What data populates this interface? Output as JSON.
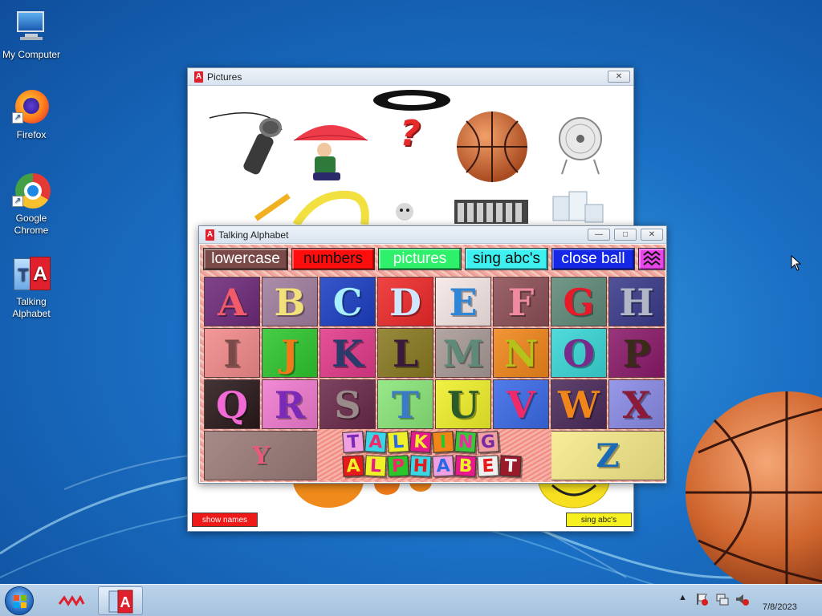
{
  "desktop": {
    "icons": [
      {
        "label": "My Computer"
      },
      {
        "label": "Firefox"
      },
      {
        "label": "Google Chrome"
      },
      {
        "label": "Talking Alphabet"
      }
    ]
  },
  "pictures_window": {
    "title": "Pictures",
    "icon_letter": "A",
    "close_label": "✕",
    "question_mark": "?",
    "show_names_label": "show names",
    "sing_abcs_label": "sing abc's"
  },
  "alphabet_window": {
    "title": "Talking Alphabet",
    "icon_letter": "A",
    "minimize_label": "—",
    "maximize_label": "□",
    "close_label": "✕",
    "menu": [
      {
        "label": "lowercase",
        "bg": "#7a4a48",
        "color": "#ffffff"
      },
      {
        "label": "numbers",
        "bg": "#ff0d0d",
        "color": "#111111"
      },
      {
        "label": "pictures",
        "bg": "#2ef06a",
        "color": "#ffffff"
      },
      {
        "label": "sing abc's",
        "bg": "#3ef0f0",
        "color": "#111111"
      },
      {
        "label": "close ball",
        "bg": "#1428e6",
        "color": "#ffffff"
      },
      {
        "label": "",
        "bg": "#e646e6",
        "color": "#111111"
      }
    ],
    "letters": [
      {
        "ch": "A",
        "bg": "#6e2a7a",
        "fg": "#f05a6a"
      },
      {
        "ch": "B",
        "bg": "#a07e9e",
        "fg": "#f2e07a"
      },
      {
        "ch": "C",
        "bg": "#1c3fc2",
        "fg": "#a8f0ff"
      },
      {
        "ch": "D",
        "bg": "#ee2a2a",
        "fg": "#cfe6ff"
      },
      {
        "ch": "E",
        "bg": "#f6e8e6",
        "fg": "#2f86d6"
      },
      {
        "ch": "F",
        "bg": "#8c4f56",
        "fg": "#f08aa0"
      },
      {
        "ch": "G",
        "bg": "#5f8a7a",
        "fg": "#e81a2a"
      },
      {
        "ch": "H",
        "bg": "#3a3a8a",
        "fg": "#b0b6c6"
      },
      {
        "ch": "I",
        "bg": "#f28a8a",
        "fg": "#7a4a48"
      },
      {
        "ch": "J",
        "bg": "#2ec62e",
        "fg": "#f07a1a"
      },
      {
        "ch": "K",
        "bg": "#e23a8a",
        "fg": "#2a3a6a"
      },
      {
        "ch": "L",
        "bg": "#8a7a22",
        "fg": "#3a1a3a"
      },
      {
        "ch": "M",
        "bg": "#a89a96",
        "fg": "#5f8a7a"
      },
      {
        "ch": "N",
        "bg": "#f0861a",
        "fg": "#b6c21a"
      },
      {
        "ch": "O",
        "bg": "#3ad6d6",
        "fg": "#7a2a8a"
      },
      {
        "ch": "P",
        "bg": "#8a1a6a",
        "fg": "#3a2a1a"
      },
      {
        "ch": "Q",
        "bg": "#2a1a1a",
        "fg": "#f26ad6"
      },
      {
        "ch": "R",
        "bg": "#f07ad0",
        "fg": "#7a2ab6"
      },
      {
        "ch": "S",
        "bg": "#6a2a4a",
        "fg": "#9a8a8a"
      },
      {
        "ch": "T",
        "bg": "#8ae67a",
        "fg": "#3a7ac6"
      },
      {
        "ch": "U",
        "bg": "#f0f02a",
        "fg": "#2a5a2a"
      },
      {
        "ch": "V",
        "bg": "#3a6ae6",
        "fg": "#f02a6a"
      },
      {
        "ch": "W",
        "bg": "#4a2a5a",
        "fg": "#f0861a"
      },
      {
        "ch": "X",
        "bg": "#8a8ae6",
        "fg": "#8a1a3a"
      },
      {
        "ch": "Y",
        "bg": "#9a7a78",
        "fg": "#e65a7a"
      },
      {
        "ch": "Z",
        "bg": "#f6ea8a",
        "fg": "#1a6ab6"
      }
    ],
    "logo_top": [
      {
        "ch": "T",
        "bg": "#f0a0e0",
        "fg": "#7a2ab6"
      },
      {
        "ch": "A",
        "bg": "#3ad6e6",
        "fg": "#f02a6a"
      },
      {
        "ch": "L",
        "bg": "#f0f02a",
        "fg": "#2a6ae6"
      },
      {
        "ch": "K",
        "bg": "#e61a8a",
        "fg": "#f0f02a"
      },
      {
        "ch": "I",
        "bg": "#f0861a",
        "fg": "#2ac62a"
      },
      {
        "ch": "N",
        "bg": "#3ac63a",
        "fg": "#f02aa0"
      },
      {
        "ch": "G",
        "bg": "#f0a0a0",
        "fg": "#7a2aa0"
      }
    ],
    "logo_bottom": [
      {
        "ch": "A",
        "bg": "#e61a1a",
        "fg": "#f0f02a"
      },
      {
        "ch": "L",
        "bg": "#f0f02a",
        "fg": "#e61a8a"
      },
      {
        "ch": "P",
        "bg": "#2ac62a",
        "fg": "#f02a6a"
      },
      {
        "ch": "H",
        "bg": "#3ad6e6",
        "fg": "#e61a1a"
      },
      {
        "ch": "A",
        "bg": "#f0a0e0",
        "fg": "#2a6ae6"
      },
      {
        "ch": "B",
        "bg": "#e61a8a",
        "fg": "#f0f02a"
      },
      {
        "ch": "E",
        "bg": "#f0f0f0",
        "fg": "#e61a1a"
      },
      {
        "ch": "T",
        "bg": "#9a1a2a",
        "fg": "#f0f0f0"
      }
    ]
  },
  "taskbar": {
    "clock_time": "",
    "clock_date": "7/8/2023"
  }
}
